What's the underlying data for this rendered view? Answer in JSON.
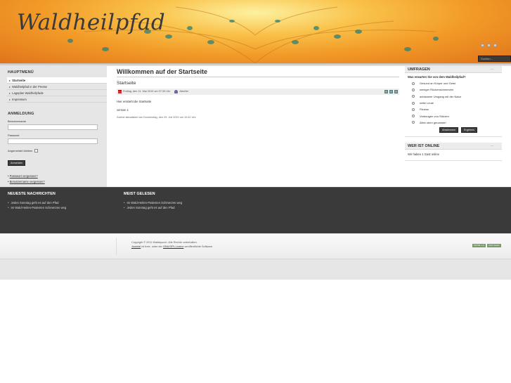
{
  "header": {
    "logo_text": "Waldheilpfad",
    "search_placeholder": "Suchen..."
  },
  "left": {
    "menu_title": "HAUPTMENÜ",
    "menu_items": [
      {
        "label": "Startseite"
      },
      {
        "label": "Waldheilpfad in der Presse"
      },
      {
        "label": "Lageplan Waldheilpfade"
      },
      {
        "label": "Impressum"
      }
    ],
    "login": {
      "title": "ANMELDUNG",
      "username_label": "Benutzername",
      "password_label": "Passwort",
      "remember_label": "Angemeldet bleiben",
      "submit_label": "Anmelden",
      "forgot_password": "Passwort vergessen?",
      "forgot_username": "Benutzername vergessen?"
    }
  },
  "main": {
    "page_heading": "Willkommen auf der Startseite",
    "article_title": "Startseite",
    "meta_date": "Freitag, den 21. Mai 2010 um 07:33 Uhr",
    "meta_author": "Ateelier",
    "body_line1": "Hier entsteht die Startseite",
    "body_line2": "version 1",
    "last_updated": "Zuletzt aktualisiert am Donnerstag, den 29. Juli 2010 um 10:42 Uhr"
  },
  "right": {
    "poll_title": "UMFRAGEN",
    "poll_question": "Was erwarten Sie von dem Waldheilpfad?",
    "poll_options": [
      "Gesund an Körper und Geist",
      "weniger Rückenschmerzen",
      "achtsamer Umgang mit der Natur",
      "nette Leute",
      "Fitness",
      "Vorbeugen von Stürzen",
      "Alles oben genannte!"
    ],
    "vote_button": "Abstimmen",
    "results_button": "Ergebnis",
    "online_title": "WER IST ONLINE",
    "online_text": "Wir haben 1 Gast online",
    "toggle_glyph": "—"
  },
  "footer": {
    "news_title": "NEUESTE NACHRICHTEN",
    "news_items": [
      "Jeden Sonntag geht es auf den Pfad",
      "Im Wald-Heilen-Patienten Schmerzen weg"
    ],
    "popular_title": "MEIST GELESEN",
    "popular_items": [
      "Im Wald-Heilen-Patienten Schmerzen weg",
      "Jeden Sonntag geht es auf den Pfad"
    ],
    "copyright_line": "Copyright © 2011 Waldepurch. Alle Rechte vorbehalten.",
    "joomla_link": "Joomla!",
    "license_mid": "ist freie, unter der",
    "gnu_link": "GNU/GPL-Lizenz",
    "license_end": "veröffentlichte Software.",
    "badges": [
      "XHTML 1.0",
      "CSS VALID"
    ]
  },
  "colors": {
    "header_orange": "#f29a28",
    "dark_band": "#3a3a3a",
    "sidebar_grey": "#e6e6e6"
  }
}
